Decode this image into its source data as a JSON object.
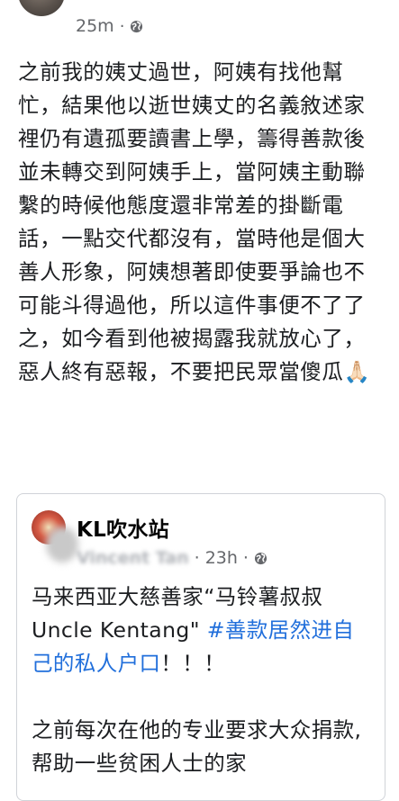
{
  "post": {
    "time": "25m",
    "separator": "·",
    "body": "之前我的姨丈過世，阿姨有找他幫忙，結果他以逝世姨丈的名義敘述家裡仍有遺孤要讀書上學，籌得善款後並未轉交到阿姨手上，當阿姨主動聯繫的時候他態度還非常差的掛斷電話，一點交代都沒有，當時他是個大善人形象，阿姨想著即使要爭論也不可能斗得過他，所以這件事便不了了之，如今看到他被揭露我就放心了，惡人終有惡報，不要把民眾當傻瓜🙏🏻"
  },
  "shared": {
    "group_name": "KL吹水站",
    "author": "Vincent Tan",
    "time": "23h",
    "separator": "·",
    "text_plain": "马来西亚大慈善家“马铃薯叔叔 Uncle Kentang\" ",
    "hashtag": "#善款居然进自己的私人户口",
    "exclaim": "！！！",
    "para2": "之前每次在他的专业要求大众捐款,帮助一些贫困人士的家"
  },
  "colors": {
    "meta_gray": "#65676b",
    "hashtag_blue": "#216fdb"
  }
}
